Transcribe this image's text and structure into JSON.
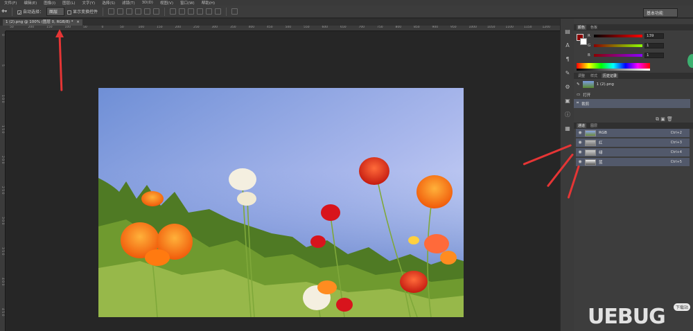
{
  "menubar": {
    "items": [
      "文件(F)",
      "编辑(E)",
      "图像(I)",
      "图层(L)",
      "文字(Y)",
      "选择(S)",
      "滤镜(T)",
      "3D(D)",
      "视图(V)",
      "窗口(W)",
      "帮助(H)"
    ]
  },
  "options_bar": {
    "auto_select_label": "自动选择：",
    "auto_select_value": "图层",
    "show_transform_label": "显示变换控件",
    "workspace": "基本功能"
  },
  "document_tab": {
    "title": "1 (2).png @ 100% (图层 0, RGB/8) *",
    "close": "×"
  },
  "ruler": {
    "h_labels": [
      "50",
      "200",
      "150",
      "100",
      "50",
      "0",
      "50",
      "100",
      "150",
      "200",
      "250",
      "300",
      "350",
      "400",
      "450",
      "500",
      "550",
      "600",
      "650",
      "700",
      "750",
      "800",
      "850",
      "900",
      "950",
      "1000",
      "1050",
      "1100",
      "1150",
      "1200"
    ],
    "v_labels": [
      "0",
      "5",
      "1 0 0",
      "1 5 0",
      "2 0 0",
      "2 5 0",
      "3 0 0",
      "3 5 0",
      "4 0 0",
      "4 5 0"
    ]
  },
  "color_panel": {
    "tabs": [
      "颜色",
      "色板"
    ],
    "r_label": "R",
    "g_label": "G",
    "b_label": "B",
    "r_value": "139",
    "g_value": "1",
    "b_value": "1",
    "foreground": "#8b0101"
  },
  "history_panel": {
    "tabs": [
      "调整",
      "样式",
      "历史记录"
    ],
    "snapshot": "1 (2).png",
    "items": [
      "打开",
      "裁剪"
    ]
  },
  "channels_panel": {
    "tabs": [
      "通道",
      "图层"
    ],
    "rows": [
      {
        "name": "RGB",
        "shortcut": "Ctrl+2"
      },
      {
        "name": "红",
        "shortcut": "Ctrl+3"
      },
      {
        "name": "绿",
        "shortcut": "Ctrl+4"
      },
      {
        "name": "蓝",
        "shortcut": "Ctrl+5"
      }
    ]
  },
  "watermark": {
    "text": "UEBUG",
    "badge": "下载站"
  }
}
